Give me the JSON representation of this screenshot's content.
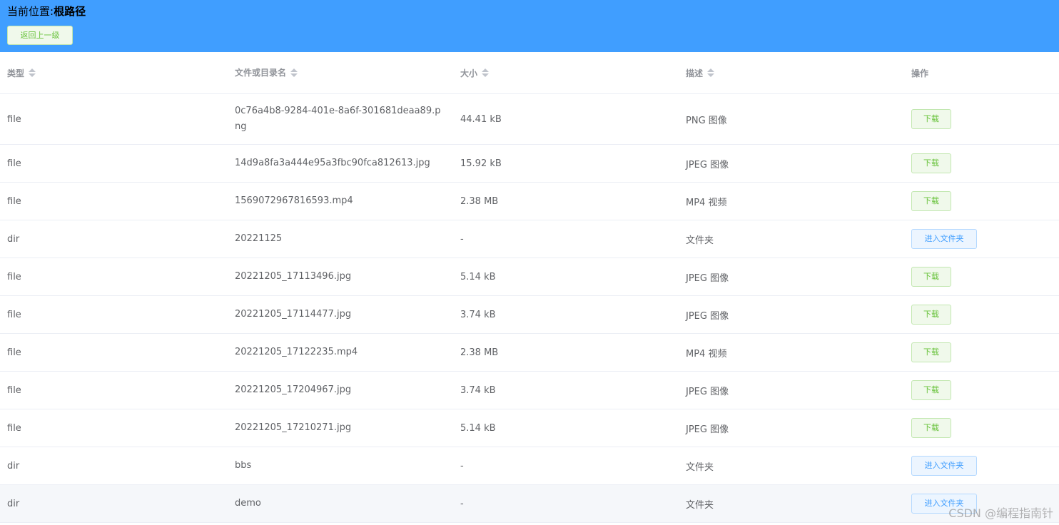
{
  "header": {
    "location_label": "当前位置:",
    "location_path": "根路径",
    "back_button": "返回上一级"
  },
  "table": {
    "columns": [
      "类型",
      "文件或目录名",
      "大小",
      "描述",
      "操作"
    ],
    "rows": [
      {
        "type": "file",
        "name": "0c76a4b8-9284-401e-8a6f-301681deaa89.png",
        "size": "44.41 kB",
        "desc": "PNG 图像",
        "action": "下载",
        "kind": "download"
      },
      {
        "type": "file",
        "name": "14d9a8fa3a444e95a3fbc90fca812613.jpg",
        "size": "15.92 kB",
        "desc": "JPEG 图像",
        "action": "下载",
        "kind": "download"
      },
      {
        "type": "file",
        "name": "1569072967816593.mp4",
        "size": "2.38 MB",
        "desc": "MP4 视频",
        "action": "下载",
        "kind": "download"
      },
      {
        "type": "dir",
        "name": "20221125",
        "size": "-",
        "desc": "文件夹",
        "action": "进入文件夹",
        "kind": "enter"
      },
      {
        "type": "file",
        "name": "20221205_17113496.jpg",
        "size": "5.14 kB",
        "desc": "JPEG 图像",
        "action": "下载",
        "kind": "download"
      },
      {
        "type": "file",
        "name": "20221205_17114477.jpg",
        "size": "3.74 kB",
        "desc": "JPEG 图像",
        "action": "下载",
        "kind": "download"
      },
      {
        "type": "file",
        "name": "20221205_17122235.mp4",
        "size": "2.38 MB",
        "desc": "MP4 视频",
        "action": "下载",
        "kind": "download"
      },
      {
        "type": "file",
        "name": "20221205_17204967.jpg",
        "size": "3.74 kB",
        "desc": "JPEG 图像",
        "action": "下载",
        "kind": "download"
      },
      {
        "type": "file",
        "name": "20221205_17210271.jpg",
        "size": "5.14 kB",
        "desc": "JPEG 图像",
        "action": "下载",
        "kind": "download"
      },
      {
        "type": "dir",
        "name": "bbs",
        "size": "-",
        "desc": "文件夹",
        "action": "进入文件夹",
        "kind": "enter"
      },
      {
        "type": "dir",
        "name": "demo",
        "size": "-",
        "desc": "文件夹",
        "action": "进入文件夹",
        "kind": "enter"
      }
    ]
  },
  "watermark": "CSDN @编程指南针"
}
